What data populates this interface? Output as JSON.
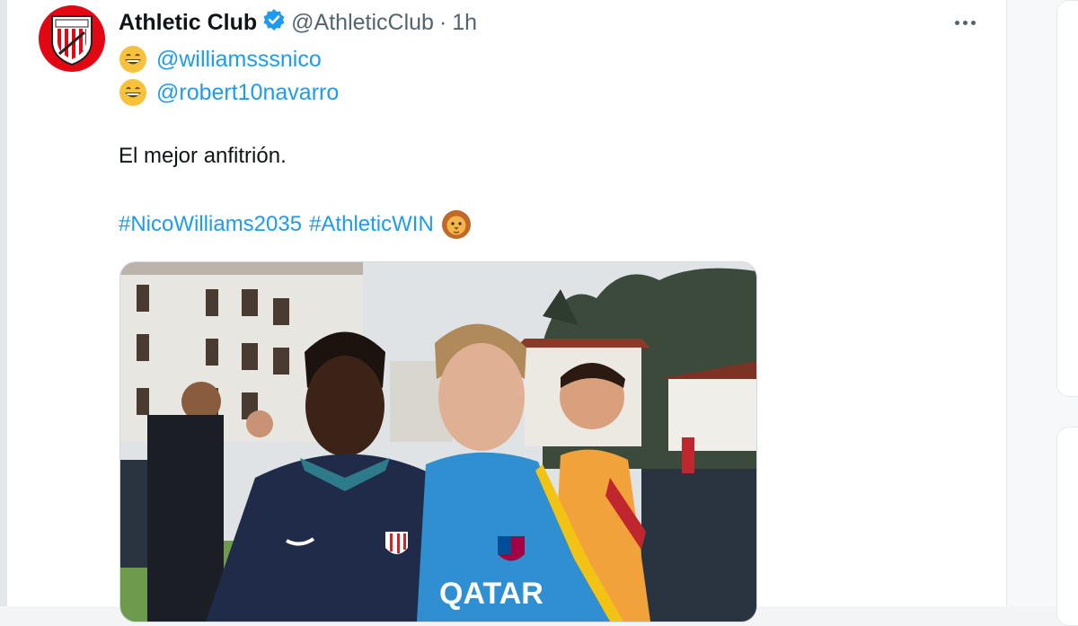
{
  "tweet": {
    "display_name": "Athletic Club",
    "handle": "@AthleticClub",
    "separator": "·",
    "time": "1h",
    "mentions": [
      "@williamsssnico",
      "@robert10navarro"
    ],
    "text": "El mejor anfitrión.",
    "hashtags": [
      "#NicoWilliams2035",
      "#AthleticWIN"
    ],
    "verified": true,
    "icons": [
      "verified-badge-icon",
      "grinning-emoji-icon",
      "lion-emoji-icon",
      "more-options-icon"
    ]
  },
  "media": {
    "jersey_text": "QATAR"
  },
  "colors": {
    "link": "#1d9bf0",
    "text": "#0f1419",
    "muted": "#536471",
    "brand_red": "#e30613"
  }
}
